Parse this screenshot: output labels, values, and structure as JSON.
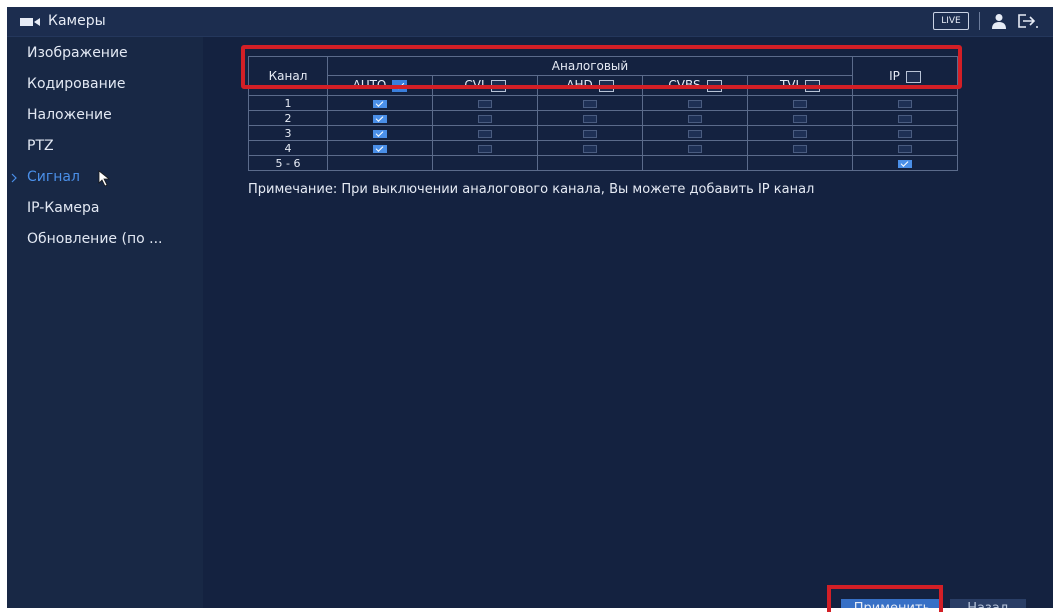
{
  "topbar": {
    "title": "Камеры",
    "title_icon": "camera-icon",
    "live_label": "LIVE",
    "user_icon": "user-icon",
    "logout_icon": "logout-icon"
  },
  "sidebar": {
    "items": [
      {
        "label": "Изображение",
        "active": false
      },
      {
        "label": "Кодирование",
        "active": false
      },
      {
        "label": "Наложение",
        "active": false
      },
      {
        "label": "PTZ",
        "active": false
      },
      {
        "label": "Сигнал",
        "active": true
      },
      {
        "label": "IP-Камера",
        "active": false
      },
      {
        "label": "Обновление (по ..."
      }
    ]
  },
  "table": {
    "channel_header": "Канал",
    "analog_header": "Аналоговый",
    "columns": [
      {
        "label": "AUTO",
        "checked": true
      },
      {
        "label": "CVI",
        "checked": false
      },
      {
        "label": "AHD",
        "checked": false
      },
      {
        "label": "CVBS",
        "checked": false
      },
      {
        "label": "TVI",
        "checked": false
      }
    ],
    "ip_header": {
      "label": "IP",
      "checked": false
    },
    "rows": [
      {
        "channel": "1",
        "auto": true,
        "cvi": false,
        "ahd": false,
        "cvbs": false,
        "tvi": false,
        "ip": false
      },
      {
        "channel": "2",
        "auto": true,
        "cvi": false,
        "ahd": false,
        "cvbs": false,
        "tvi": false,
        "ip": false
      },
      {
        "channel": "3",
        "auto": true,
        "cvi": false,
        "ahd": false,
        "cvbs": false,
        "tvi": false,
        "ip": false
      },
      {
        "channel": "4",
        "auto": true,
        "cvi": false,
        "ahd": false,
        "cvbs": false,
        "tvi": false,
        "ip": false
      },
      {
        "channel": "5 - 6",
        "analog_empty": true,
        "ip": true
      }
    ]
  },
  "note": "Примечание: При выключении аналогового канала, Вы можете добавить IP канал",
  "buttons": {
    "apply": "Применить",
    "back": "Назад"
  },
  "colors": {
    "background": "#142240",
    "sidebar": "#182845",
    "accent": "#4a8fe8",
    "highlight": "#d31f26"
  }
}
